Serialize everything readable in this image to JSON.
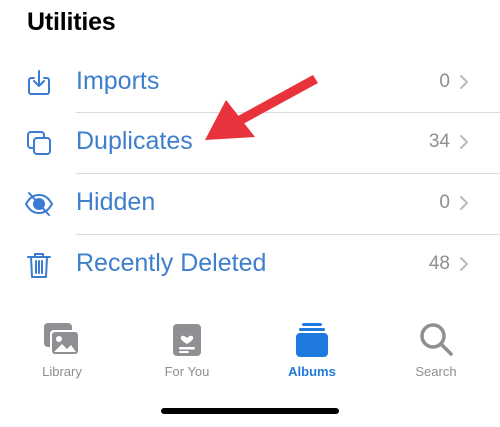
{
  "section": {
    "title": "Utilities"
  },
  "rows": [
    {
      "label": "Imports",
      "count": "0",
      "icon": "import-tray-icon"
    },
    {
      "label": "Duplicates",
      "count": "34",
      "icon": "duplicate-squares-icon"
    },
    {
      "label": "Hidden",
      "count": "0",
      "icon": "eye-slash-icon"
    },
    {
      "label": "Recently Deleted",
      "count": "48",
      "icon": "trash-icon"
    }
  ],
  "tabbar": {
    "tabs": [
      {
        "label": "Library",
        "icon": "photo-library-icon",
        "active": false
      },
      {
        "label": "For You",
        "icon": "for-you-icon",
        "active": false
      },
      {
        "label": "Albums",
        "icon": "albums-stack-icon",
        "active": true
      },
      {
        "label": "Search",
        "icon": "magnifier-icon",
        "active": false
      }
    ]
  },
  "colors": {
    "accent": "#1f7ae0",
    "row_text": "#3e7fcd",
    "secondary": "#8e8e93",
    "arrow": "#e8323c"
  }
}
